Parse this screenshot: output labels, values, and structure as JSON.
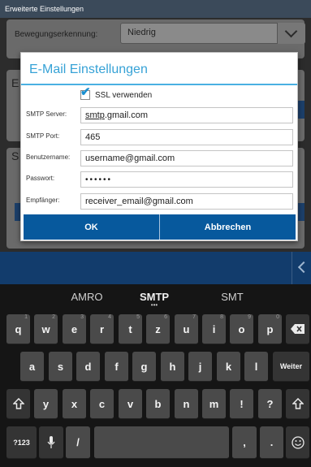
{
  "titlebar": {
    "title": "Erweiterte Einstellungen"
  },
  "background": {
    "motion_label": "Bewegungserkennung:",
    "motion_value": "Niedrig",
    "section_letters": [
      "E",
      "S"
    ]
  },
  "dialog": {
    "title": "E-Mail Einstellungen",
    "ssl_label": "SSL verwenden",
    "ssl_checked": true,
    "fields": [
      {
        "label": "SMTP Server:",
        "value_prefix": "smtp",
        "value_rest": ".gmail.com"
      },
      {
        "label": "SMTP Port:",
        "value": "465"
      },
      {
        "label": "Benutzername:",
        "value": "username@gmail.com"
      },
      {
        "label": "Passwort:",
        "value": "••••••"
      },
      {
        "label": "Empfänger:",
        "value": "receiver_email@gmail.com"
      }
    ],
    "ok_label": "OK",
    "cancel_label": "Abbrechen"
  },
  "keyboard": {
    "suggestions": [
      "AMRO",
      "SMTP",
      "SMT"
    ],
    "row1": [
      {
        "label": "q",
        "num": "1"
      },
      {
        "label": "w",
        "num": "2"
      },
      {
        "label": "e",
        "num": "3"
      },
      {
        "label": "r",
        "num": "4"
      },
      {
        "label": "t",
        "num": "5"
      },
      {
        "label": "z",
        "num": "6"
      },
      {
        "label": "u",
        "num": "7"
      },
      {
        "label": "i",
        "num": "8"
      },
      {
        "label": "o",
        "num": "9"
      },
      {
        "label": "p",
        "num": "0"
      }
    ],
    "row2": [
      "a",
      "s",
      "d",
      "f",
      "g",
      "h",
      "j",
      "k",
      "l"
    ],
    "enter_label": "Weiter",
    "row3": [
      "y",
      "x",
      "c",
      "v",
      "b",
      "n",
      "m",
      "!",
      "?"
    ],
    "symbols_label": "?123",
    "comma": ",",
    "period": ".",
    "slash": "/",
    "icons": {
      "backspace": "backspace-icon",
      "shift": "shift-icon",
      "mic": "microphone-icon",
      "emoji": "emoji-icon",
      "back": "chevron-left-icon"
    }
  },
  "colors": {
    "accent": "#36a2d6",
    "button_blue": "#07599d",
    "titlebar": "#3b4a5a",
    "keyboard_bg": "#151515",
    "key": "#4a4a4a"
  }
}
